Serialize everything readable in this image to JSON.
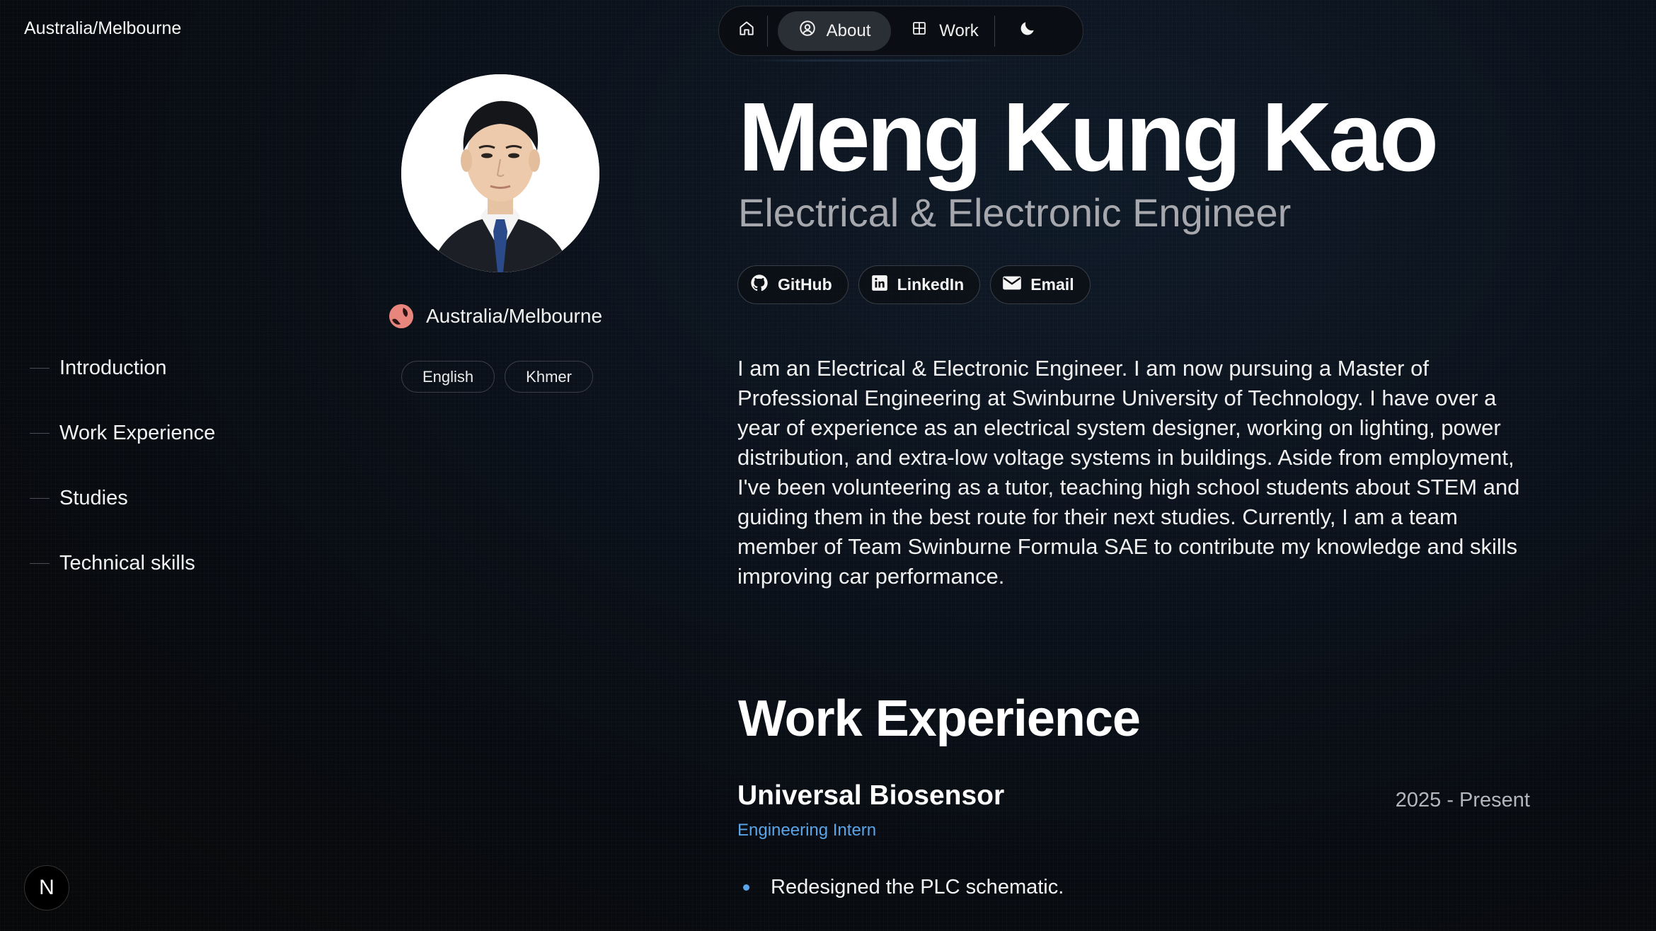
{
  "header": {
    "location": "Australia/Melbourne"
  },
  "nav": {
    "about_label": "About",
    "work_label": "Work",
    "icons": [
      "home-icon",
      "person-circle-icon",
      "grid-icon",
      "moon-icon"
    ]
  },
  "profile": {
    "location": "Australia/Melbourne",
    "languages": [
      "English",
      "Khmer"
    ]
  },
  "toc": {
    "items": [
      "Introduction",
      "Work Experience",
      "Studies",
      "Technical skills"
    ]
  },
  "hero": {
    "name": "Meng Kung Kao",
    "role": "Electrical & Electronic Engineer"
  },
  "socials": [
    {
      "label": "GitHub",
      "icon": "github-icon"
    },
    {
      "label": "LinkedIn",
      "icon": "linkedin-icon"
    },
    {
      "label": "Email",
      "icon": "mail-icon"
    }
  ],
  "intro": "I am an Electrical & Electronic Engineer. I am now pursuing a Master of Professional Engineering at Swinburne University of Technology. I have over a year of experience as an electrical system designer, working on lighting, power distribution, and extra-low voltage systems in buildings. Aside from employment, I've been volunteering as a tutor, teaching high school students about STEM and guiding them in the best route for their next studies. Currently, I am a team member of Team Swinburne Formula SAE to contribute my knowledge and skills improving car performance.",
  "work": {
    "heading": "Work Experience",
    "jobs": [
      {
        "company": "Universal Biosensor",
        "period": "2025 - Present",
        "role": "Engineering Intern",
        "bullets": [
          "Redesigned the PLC schematic."
        ]
      }
    ]
  },
  "badge": {
    "letter": "N"
  },
  "colors": {
    "accent": "#5aa4e8",
    "background": "#0b121c"
  }
}
